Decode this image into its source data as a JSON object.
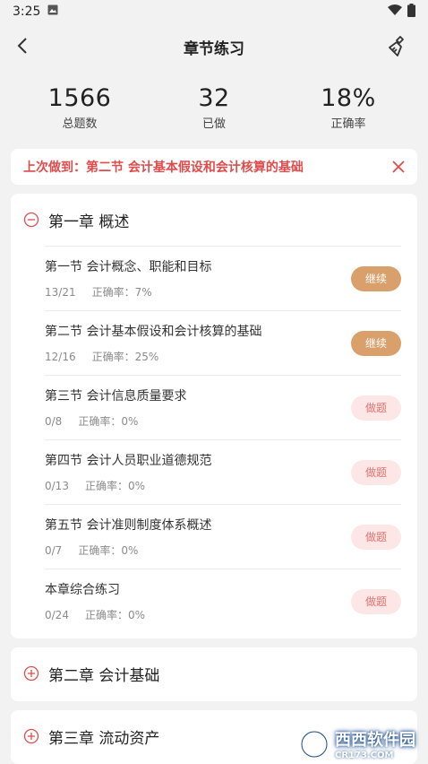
{
  "status": {
    "time": "3:25"
  },
  "header": {
    "title": "章节练习"
  },
  "stats": [
    {
      "value": "1566",
      "label": "总题数"
    },
    {
      "value": "32",
      "label": "已做"
    },
    {
      "value": "18%",
      "label": "正确率"
    }
  ],
  "last": {
    "text": "上次做到：第二节 会计基本假设和会计核算的基础"
  },
  "chapters": [
    {
      "title": "第一章 概述",
      "expanded": true,
      "sections": [
        {
          "title": "第一节 会计概念、职能和目标",
          "progress": "13/21",
          "accuracy": "正确率：7%",
          "action": "继续"
        },
        {
          "title": "第二节 会计基本假设和会计核算的基础",
          "progress": "12/16",
          "accuracy": "正确率：25%",
          "action": "继续"
        },
        {
          "title": "第三节 会计信息质量要求",
          "progress": "0/8",
          "accuracy": "正确率：0%",
          "action": "做题"
        },
        {
          "title": "第四节 会计人员职业道德规范",
          "progress": "0/13",
          "accuracy": "正确率：0%",
          "action": "做题"
        },
        {
          "title": "第五节 会计准则制度体系概述",
          "progress": "0/7",
          "accuracy": "正确率：0%",
          "action": "做题"
        },
        {
          "title": "本章综合练习",
          "progress": "0/24",
          "accuracy": "正确率：0%",
          "action": "做题"
        }
      ]
    },
    {
      "title": "第二章 会计基础",
      "expanded": false
    },
    {
      "title": "第三章 流动资产",
      "expanded": false
    }
  ],
  "watermark": {
    "main": "西西软件园",
    "sub": "CR173.COM"
  },
  "colors": {
    "accent_red": "#e14b4b",
    "continue_btn": "#d9a06c",
    "do_btn_bg": "#fde6e6"
  }
}
